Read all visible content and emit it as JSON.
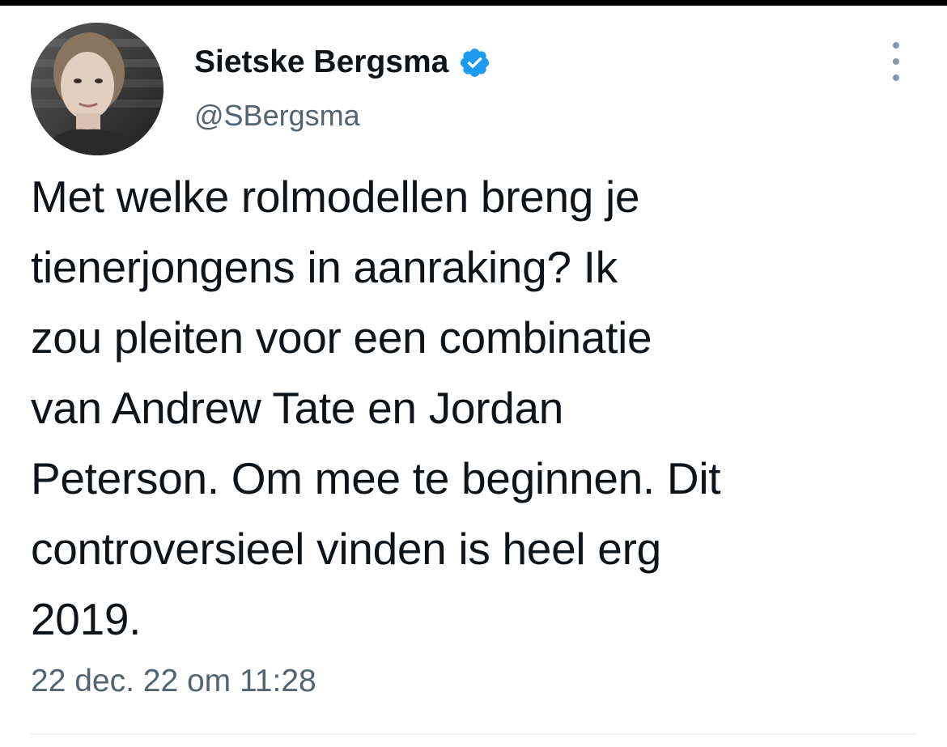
{
  "tweet": {
    "author": {
      "display_name": "Sietske Bergsma",
      "handle": "@SBergsma",
      "verified": true,
      "verified_icon": "verified-badge-icon",
      "avatar": "profile-photo"
    },
    "text": "Met welke rolmodellen breng je\ntienerjongens in aanraking? Ik\nzou pleiten voor een combinatie\nvan Andrew Tate en Jordan\nPeterson. Om mee te beginnen. Dit\ncontroversieel vinden is heel erg\n2019.",
    "timestamp": "22 dec. 22 om 11:28",
    "menu_icon": "more-options-icon"
  },
  "colors": {
    "text_primary": "#0f1419",
    "text_secondary": "#536471",
    "verified_blue": "#1d9bf0",
    "divider": "#eff3f4",
    "status_bar": "#000000"
  }
}
